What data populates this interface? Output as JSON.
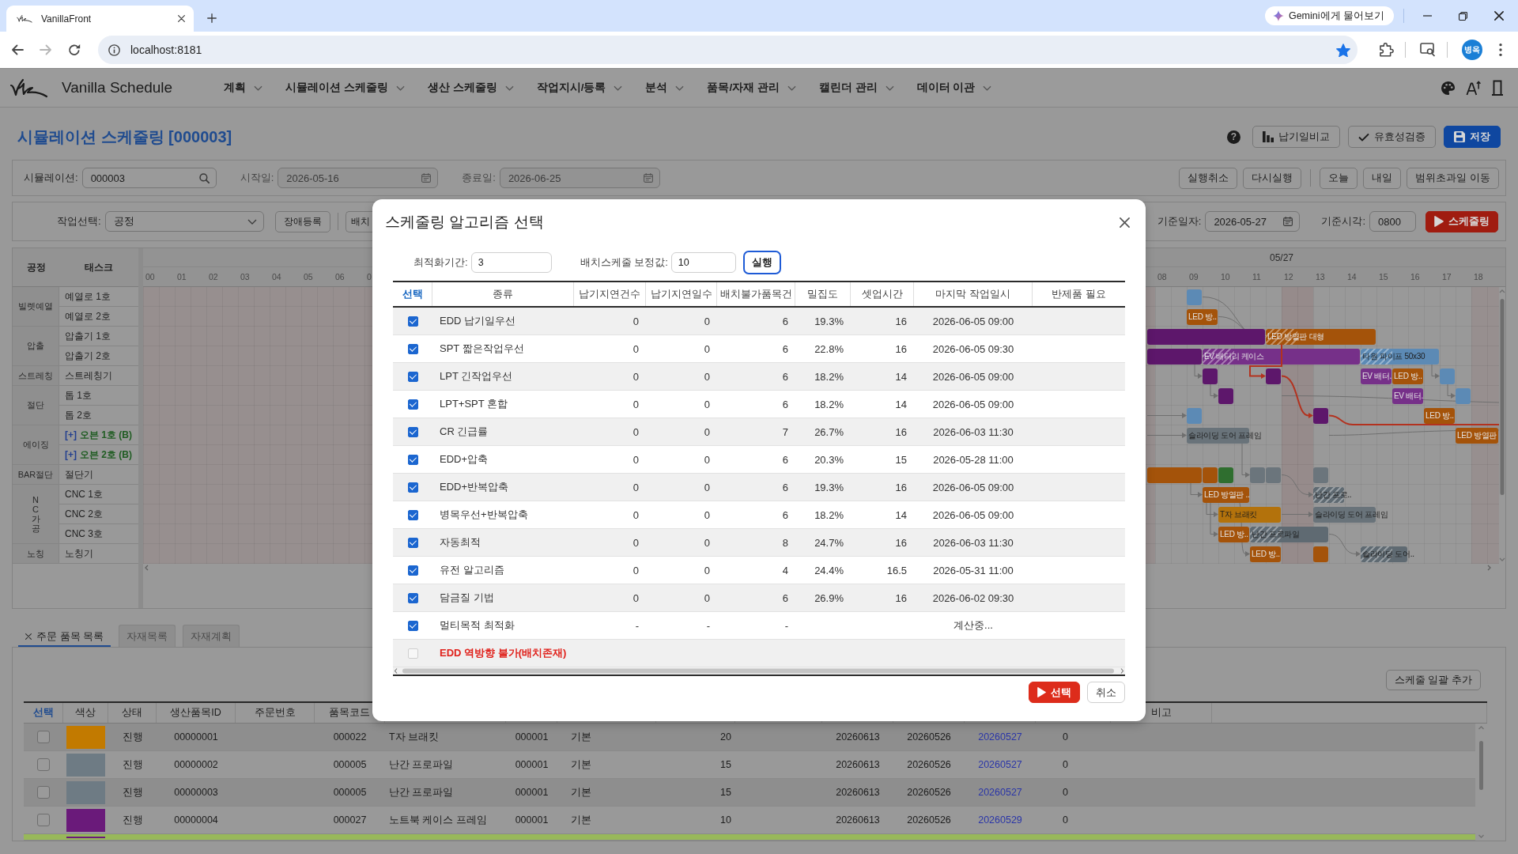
{
  "browser": {
    "tab_title": "VanillaFront",
    "assistant_chip": "Gemini에게 물어보기",
    "url": "localhost:8181",
    "bookmarked": true,
    "profile_initials": "병옥"
  },
  "app": {
    "title": "Vanilla Schedule",
    "menu": [
      {
        "label": "계획"
      },
      {
        "label": "시뮬레이션 스케줄링"
      },
      {
        "label": "생산 스케줄링"
      },
      {
        "label": "작업지시/등록"
      },
      {
        "label": "분석"
      },
      {
        "label": "품목/자재 관리"
      },
      {
        "label": "캘린더 관리"
      },
      {
        "label": "데이터 이관"
      }
    ]
  },
  "page": {
    "title": "시뮬레이션 스케줄링 [000003]",
    "help": "?",
    "actions": [
      {
        "label": "납기일비교",
        "kind": "chart"
      },
      {
        "label": "유효성검증",
        "kind": "check"
      },
      {
        "label": "저장",
        "kind": "save"
      }
    ]
  },
  "filters": {
    "fields": [
      {
        "label": "시뮬레이션:",
        "value": "000003",
        "kind": "search",
        "disabled": false
      },
      {
        "label": "시작일:",
        "value": "2026-05-16",
        "kind": "date",
        "disabled": true
      },
      {
        "label": "종료일:",
        "value": "2026-06-25",
        "kind": "date",
        "disabled": true
      }
    ],
    "history_buttons": [
      {
        "label": "실행취소"
      },
      {
        "label": "다시실행"
      }
    ],
    "date_buttons": [
      {
        "label": "오늘"
      },
      {
        "label": "내일"
      },
      {
        "label": "범위초과일 이동"
      }
    ]
  },
  "controls": {
    "job_select": {
      "label": "작업선택:",
      "value": "공정"
    },
    "buttons": [
      {
        "label": "장애등록"
      },
      {
        "label": "배치"
      }
    ],
    "base_date": {
      "label": "기준일자:",
      "value": "2026-05-27"
    },
    "base_time": {
      "label": "기준시각:",
      "value": "0800"
    },
    "run_button": "스케줄링"
  },
  "gantt": {
    "columns": [
      "공정",
      "태스크"
    ],
    "groups": [
      {
        "name": "빌렛예열",
        "vertical": false,
        "tasks": [
          {
            "label": "예열로 1호",
            "kind": "machine",
            "bars": [
              {
                "color": "#5c8ab5",
                "hatched": false
              }
            ]
          },
          {
            "label": "예열로 2호",
            "kind": "machine",
            "bars": [
              {
                "label": "LED 방..",
                "color": "#a4530a",
                "hatched": false
              }
            ]
          }
        ]
      },
      {
        "name": "압출",
        "vertical": false,
        "tasks": [
          {
            "label": "압출기 1호",
            "kind": "machine",
            "bars": [
              {
                "color": "#5d176b",
                "hatched": false
              },
              {
                "label": "LED 방열판 대형",
                "color": "#a4530a",
                "hatched": true
              }
            ]
          },
          {
            "label": "압출기 2호",
            "kind": "machine",
            "bars": [
              {
                "color": "#5d176b",
                "hatched": false
              },
              {
                "label": "EV 배터리 케이스",
                "color": "#763089",
                "hatched": true
              },
              {
                "label": "타원 파이프 50x30",
                "color": "#5c8ab5",
                "hatched": true
              }
            ]
          }
        ]
      },
      {
        "name": "스트레칭",
        "vertical": false,
        "tasks": [
          {
            "label": "스트레칭기",
            "kind": "machine",
            "bars": [
              {
                "color": "#5d176b",
                "hatched": false
              },
              {
                "color": "#5d176b",
                "hatched": false
              },
              {
                "label": "EV 배터.",
                "color": "#763089",
                "hatched": false
              },
              {
                "label": "LED 방..",
                "color": "#a4530a",
                "hatched": false
              },
              {
                "color": "#5c8ab5",
                "hatched": false
              }
            ]
          }
        ]
      },
      {
        "name": "절단",
        "vertical": false,
        "tasks": [
          {
            "label": "톱 1호",
            "kind": "machine",
            "bars": [
              {
                "color": "#5d176b",
                "hatched": false
              },
              {
                "label": "EV 배터.",
                "color": "#763089",
                "hatched": false
              },
              {
                "color": "#5c8ab5",
                "hatched": false
              }
            ]
          },
          {
            "label": "톱 2호",
            "kind": "machine",
            "bars": [
              {
                "color": "#5c8ab5",
                "hatched": false
              },
              {
                "color": "#5d176b",
                "hatched": false
              },
              {
                "label": "LED 방..",
                "color": "#a4530a",
                "hatched": false
              }
            ]
          }
        ]
      },
      {
        "name": "에이징",
        "vertical": false,
        "tasks": [
          {
            "toggle": "[+]",
            "label": "오븐 1호 (B)",
            "kind": "batch",
            "bars": [
              {
                "label": "슬라이딩 도어 프레임",
                "color": "#69737a",
                "hatched": false
              },
              {
                "label": "LED 방열판",
                "color": "#a4530a",
                "hatched": false
              }
            ]
          },
          {
            "toggle": "[+]",
            "label": "오븐 2호 (B)",
            "kind": "batch"
          }
        ]
      },
      {
        "name": "BAR절단",
        "vertical": false,
        "tasks": [
          {
            "label": "절단기",
            "kind": "machine",
            "bars": [
              {
                "color": "#a4530a",
                "hatched": false
              },
              {
                "color": "#a4530a",
                "hatched": false
              },
              {
                "color": "#2f6e2f",
                "hatched": false
              },
              {
                "color": "#6b757c",
                "hatched": false
              },
              {
                "color": "#6b757c",
                "hatched": false
              },
              {
                "color": "#6b757c",
                "hatched": false
              }
            ]
          }
        ]
      },
      {
        "name": "NC가공",
        "vertical": true,
        "tasks": [
          {
            "label": "CNC 1호",
            "kind": "machine",
            "bars": [
              {
                "label": "LED 방열판 ..",
                "color": "#a4530a",
                "hatched": false
              },
              {
                "label": "난간 프로..",
                "color": "#5f6a72",
                "hatched": true
              }
            ]
          },
          {
            "label": "CNC 2호",
            "kind": "machine",
            "bars": [
              {
                "label": "T자 브래킷",
                "color": "#b3720c",
                "hatched": false
              },
              {
                "label": "슬라이딩 도어 프레임",
                "color": "#69737a",
                "hatched": false
              }
            ]
          },
          {
            "label": "CNC 3호",
            "kind": "machine",
            "bars": [
              {
                "label": "LED 방..",
                "color": "#a4530a",
                "hatched": false
              },
              {
                "label": "난간 프로파일",
                "color": "#5f6a72",
                "hatched": true
              }
            ]
          }
        ]
      },
      {
        "name": "노칭",
        "vertical": false,
        "tasks": [
          {
            "label": "노칭기",
            "kind": "machine",
            "bars": [
              {
                "label": "LED 방..",
                "color": "#a4530a",
                "hatched": false
              },
              {
                "color": "#a4530a",
                "hatched": false
              },
              {
                "label": "슬라이딩 도어..",
                "color": "#5f6a72",
                "hatched": true
              }
            ]
          }
        ]
      }
    ],
    "day_label": "05/27",
    "hours": [
      "00",
      "01",
      "02",
      "03",
      "04",
      "05",
      "06",
      "0",
      "08",
      "09",
      "10",
      "11",
      "12",
      "13",
      "14",
      "15",
      "16",
      "17",
      "18"
    ]
  },
  "orders": {
    "tabs": [
      {
        "label": "주문 품목 목록",
        "selected": true,
        "closable": true
      },
      {
        "label": "자재목록",
        "selected": false,
        "closable": false
      },
      {
        "label": "자재계획",
        "selected": false,
        "closable": false
      }
    ],
    "bulk_add_button": "스케줄 일괄 추가",
    "columns": [
      "선택",
      "색상",
      "상태",
      "생산품목ID",
      "주문번호",
      "품목코드"
    ],
    "last_column": "비고",
    "rows": [
      {
        "selected": false,
        "color": "#c27a00",
        "highlighted": false,
        "status": "진행",
        "production_item_id": "00000001",
        "item_code": "000022",
        "column_7": "T자 브래킷",
        "column_8": "000001",
        "column_9": "기본",
        "column_10": "20",
        "column_11": "20260613",
        "column_12": "20260526",
        "column_13": "20260527",
        "column_14": "0"
      },
      {
        "selected": false,
        "color": "#6e7b84",
        "highlighted": false,
        "status": "진행",
        "production_item_id": "00000002",
        "item_code": "000005",
        "column_7": "난간 프로파일",
        "column_8": "000001",
        "column_9": "기본",
        "column_10": "15",
        "column_11": "20260613",
        "column_12": "20260526",
        "column_13": "20260527",
        "column_14": "0"
      },
      {
        "selected": false,
        "color": "#6e7b84",
        "highlighted": false,
        "status": "진행",
        "production_item_id": "00000003",
        "item_code": "000005",
        "column_7": "난간 프로파일",
        "column_8": "000001",
        "column_9": "기본",
        "column_10": "15",
        "column_11": "20260613",
        "column_12": "20260526",
        "column_13": "20260527",
        "column_14": "0"
      },
      {
        "selected": false,
        "color": "#6a1a7a",
        "highlighted": false,
        "status": "진행",
        "production_item_id": "00000004",
        "item_code": "000027",
        "column_7": "노트북 케이스 프레임",
        "column_8": "000001",
        "column_9": "기본",
        "column_10": "10",
        "column_11": "20260613",
        "column_12": "20260526",
        "column_13": "20260529",
        "column_14": "0"
      },
      {
        "color": "#6a1a7a",
        "highlighted": true
      }
    ]
  },
  "dialog": {
    "title": "스케줄링 알고리즘 선택",
    "params": [
      {
        "label": "최적화기간:",
        "value": "3"
      },
      {
        "label": "배치스케줄 보정값:",
        "value": "10"
      }
    ],
    "run_button": "실행",
    "columns": [
      "선택",
      "종류",
      "납기지연건수",
      "납기지연일수",
      "배치불가품목건",
      "밀집도",
      "셋업시간",
      "마지막 작업일시",
      "반제품 필요"
    ],
    "rows": [
      {
        "checked": true,
        "disabled": false,
        "name": "EDD 납기일우선",
        "late_count": "0",
        "late_days": "0",
        "unbatchable_items": "6",
        "density": "19.3%",
        "setup_time": "16",
        "last_run": "2026-06-05 09:00"
      },
      {
        "checked": true,
        "disabled": false,
        "name": "SPT 짧은작업우선",
        "late_count": "0",
        "late_days": "0",
        "unbatchable_items": "6",
        "density": "22.8%",
        "setup_time": "16",
        "last_run": "2026-06-05 09:30"
      },
      {
        "checked": true,
        "disabled": false,
        "name": "LPT 긴작업우선",
        "late_count": "0",
        "late_days": "0",
        "unbatchable_items": "6",
        "density": "18.2%",
        "setup_time": "14",
        "last_run": "2026-06-05 09:00"
      },
      {
        "checked": true,
        "disabled": false,
        "name": "LPT+SPT 혼합",
        "late_count": "0",
        "late_days": "0",
        "unbatchable_items": "6",
        "density": "18.2%",
        "setup_time": "14",
        "last_run": "2026-06-05 09:00"
      },
      {
        "checked": true,
        "disabled": false,
        "name": "CR 긴급률",
        "late_count": "0",
        "late_days": "0",
        "unbatchable_items": "7",
        "density": "26.7%",
        "setup_time": "16",
        "last_run": "2026-06-03 11:30"
      },
      {
        "checked": true,
        "disabled": false,
        "name": "EDD+압축",
        "late_count": "0",
        "late_days": "0",
        "unbatchable_items": "6",
        "density": "20.3%",
        "setup_time": "15",
        "last_run": "2026-05-28 11:00"
      },
      {
        "checked": true,
        "disabled": false,
        "name": "EDD+반복압축",
        "late_count": "0",
        "late_days": "0",
        "unbatchable_items": "6",
        "density": "19.3%",
        "setup_time": "16",
        "last_run": "2026-06-05 09:00"
      },
      {
        "checked": true,
        "disabled": false,
        "name": "병목우선+반복압축",
        "late_count": "0",
        "late_days": "0",
        "unbatchable_items": "6",
        "density": "18.2%",
        "setup_time": "14",
        "last_run": "2026-06-05 09:00"
      },
      {
        "checked": true,
        "disabled": false,
        "name": "자동최적",
        "late_count": "0",
        "late_days": "0",
        "unbatchable_items": "8",
        "density": "24.7%",
        "setup_time": "16",
        "last_run": "2026-06-03 11:30"
      },
      {
        "checked": true,
        "disabled": false,
        "name": "유전 알고리즘",
        "late_count": "0",
        "late_days": "0",
        "unbatchable_items": "4",
        "density": "24.4%",
        "setup_time": "16.5",
        "last_run": "2026-05-31 11:00"
      },
      {
        "checked": true,
        "disabled": false,
        "name": "담금질 기법",
        "late_count": "0",
        "late_days": "0",
        "unbatchable_items": "6",
        "density": "26.9%",
        "setup_time": "16",
        "last_run": "2026-06-02 09:30"
      },
      {
        "checked": true,
        "disabled": false,
        "name": "멀티목적 최적화",
        "late_count": "-",
        "late_days": "-",
        "unbatchable_items": "-",
        "last_run": "계산중..."
      },
      {
        "checked": false,
        "disabled": true,
        "name": "EDD 역방향 불가(배치존재)"
      }
    ],
    "buttons": [
      {
        "label": "선택",
        "kind": "primary"
      },
      {
        "label": "취소",
        "kind": "secondary"
      }
    ]
  }
}
